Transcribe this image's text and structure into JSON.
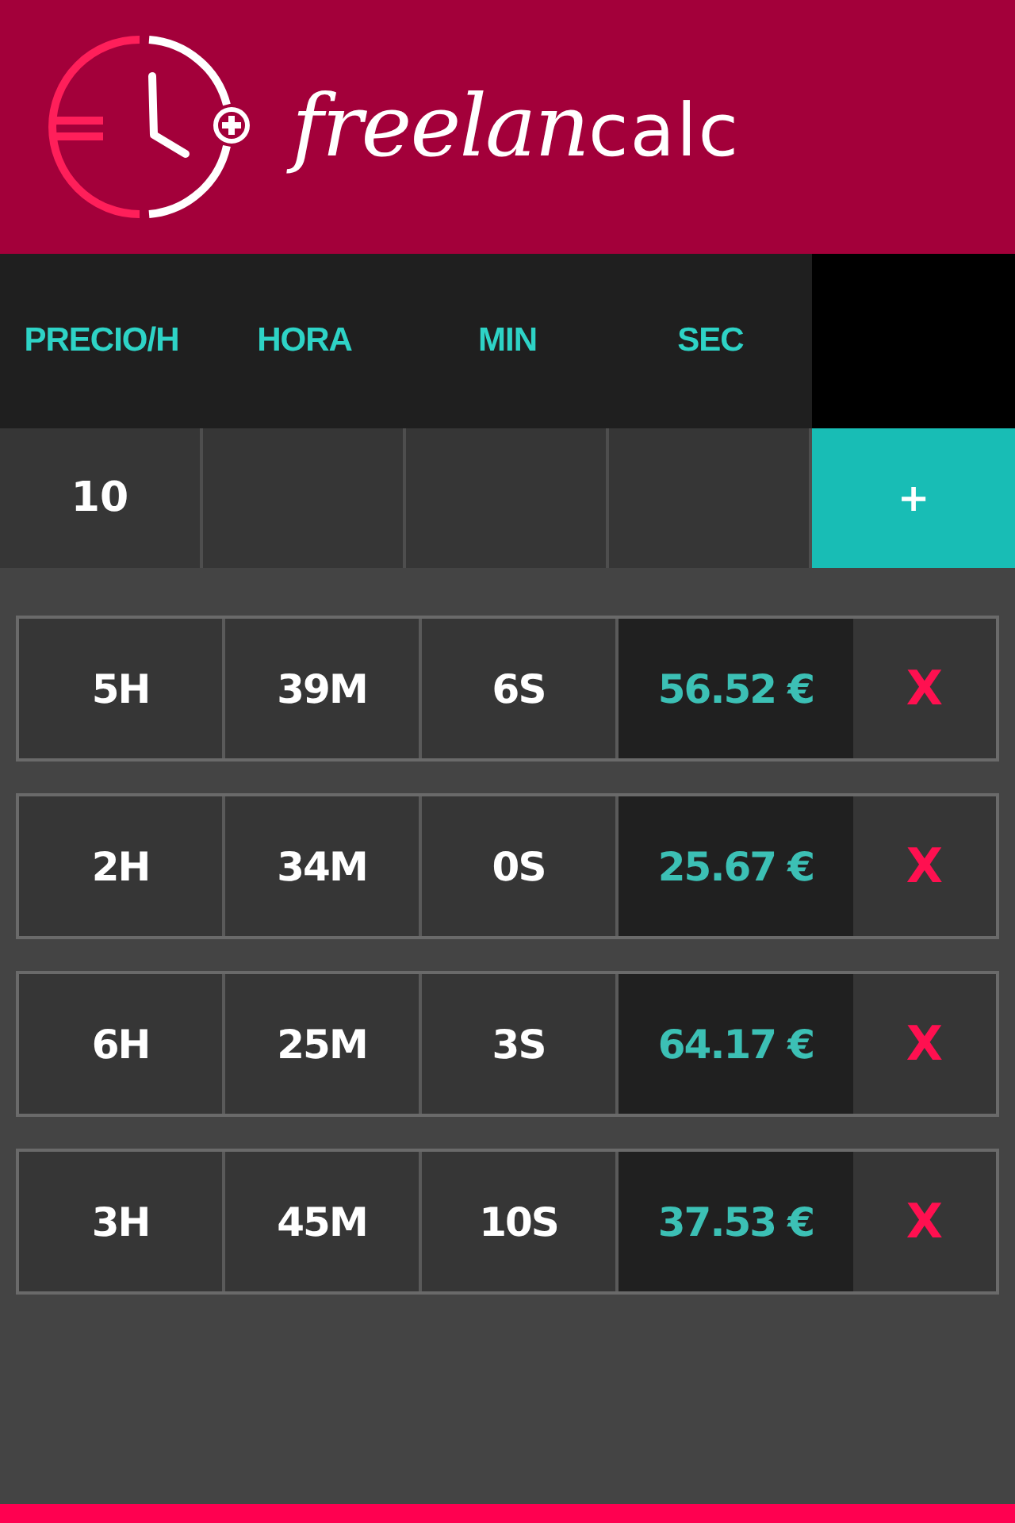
{
  "header": {
    "logo_script": "freelan",
    "logo_block": "calc"
  },
  "columns": [
    "PRECIO/H",
    "HORA",
    "MIN",
    "SEC"
  ],
  "input_values": [
    "10"
  ],
  "add_button": {
    "label": "+"
  },
  "entries": [
    {
      "hours": "5H",
      "minutes": "39M",
      "seconds": "6S",
      "amount": "56.52 €",
      "delete_label": "X"
    },
    {
      "hours": "2H",
      "minutes": "34M",
      "seconds": "0S",
      "amount": "25.67 €",
      "delete_label": "X"
    },
    {
      "hours": "6H",
      "minutes": "25M",
      "seconds": "3S",
      "amount": "64.17 €",
      "delete_label": "X"
    },
    {
      "hours": "3H",
      "minutes": "45M",
      "seconds": "10S",
      "amount": "37.53 €",
      "delete_label": "X"
    }
  ]
}
